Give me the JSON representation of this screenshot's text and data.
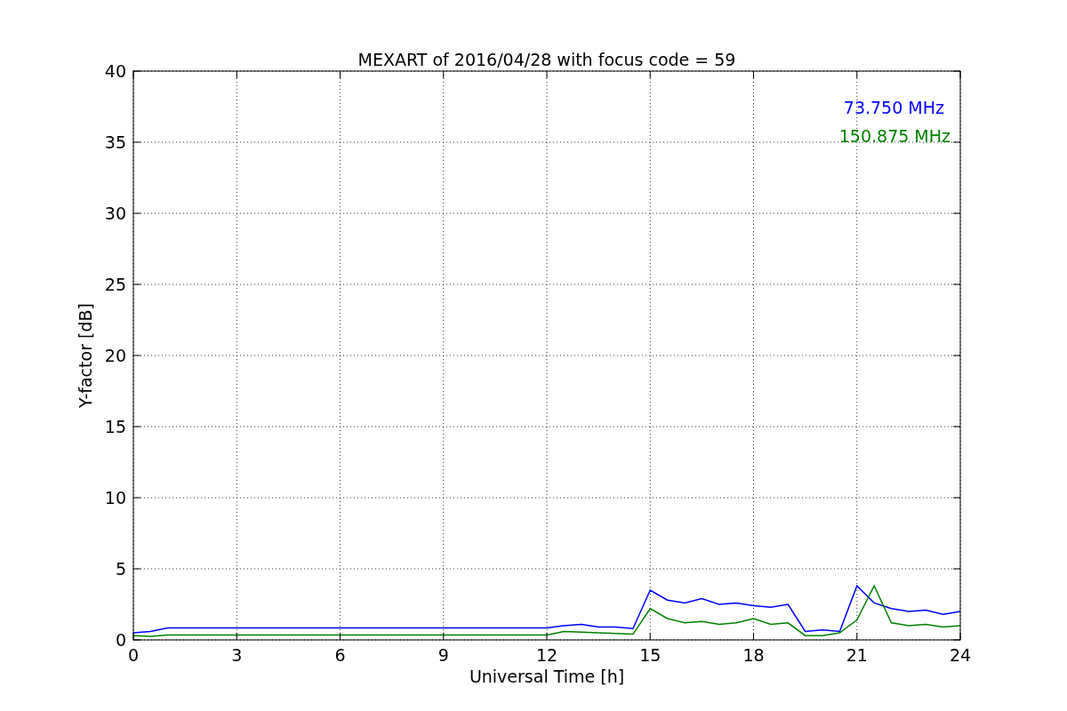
{
  "chart_data": {
    "type": "line",
    "title": "MEXART of 2016/04/28 with focus code = 59",
    "xlabel": "Universal Time [h]",
    "ylabel": "Y-factor [dB]",
    "x": [
      0,
      0.5,
      1,
      1.5,
      2,
      2.5,
      3,
      3.5,
      4,
      4.5,
      5,
      5.5,
      6,
      6.5,
      7,
      7.5,
      8,
      8.5,
      9,
      9.5,
      10,
      10.5,
      11,
      11.5,
      12,
      12.5,
      13,
      13.5,
      14,
      14.5,
      15,
      15.5,
      16,
      16.5,
      17,
      17.5,
      18,
      18.5,
      19,
      19.5,
      20,
      20.5,
      21,
      21.5,
      22,
      22.5,
      23,
      23.5,
      24
    ],
    "series": [
      {
        "name": "73.750 MHz",
        "color": "#0000ff",
        "values": [
          0.5,
          0.6,
          0.85,
          0.85,
          0.85,
          0.85,
          0.85,
          0.85,
          0.85,
          0.85,
          0.85,
          0.85,
          0.85,
          0.85,
          0.85,
          0.85,
          0.85,
          0.85,
          0.85,
          0.85,
          0.85,
          0.85,
          0.85,
          0.85,
          0.85,
          1.0,
          1.1,
          0.9,
          0.9,
          0.8,
          3.5,
          2.8,
          2.6,
          2.9,
          2.5,
          2.6,
          2.4,
          2.3,
          2.5,
          0.6,
          0.7,
          0.6,
          3.8,
          2.6,
          2.2,
          2.0,
          2.1,
          1.8,
          2.0
        ]
      },
      {
        "name": "150.875 MHz",
        "color": "#008000",
        "values": [
          0.3,
          0.25,
          0.35,
          0.35,
          0.35,
          0.35,
          0.35,
          0.35,
          0.35,
          0.35,
          0.35,
          0.35,
          0.35,
          0.35,
          0.35,
          0.35,
          0.35,
          0.35,
          0.35,
          0.35,
          0.35,
          0.35,
          0.35,
          0.35,
          0.35,
          0.6,
          0.55,
          0.5,
          0.45,
          0.4,
          2.2,
          1.5,
          1.2,
          1.3,
          1.1,
          1.2,
          1.5,
          1.1,
          1.2,
          0.3,
          0.3,
          0.5,
          1.4,
          3.8,
          1.2,
          1.0,
          1.1,
          0.9,
          1.0
        ]
      }
    ],
    "xlim": [
      0,
      24
    ],
    "ylim": [
      0,
      40
    ],
    "xticks": [
      0,
      3,
      6,
      9,
      12,
      15,
      18,
      21,
      24
    ],
    "yticks": [
      0,
      5,
      10,
      15,
      20,
      25,
      30,
      35,
      40
    ],
    "grid": true
  }
}
